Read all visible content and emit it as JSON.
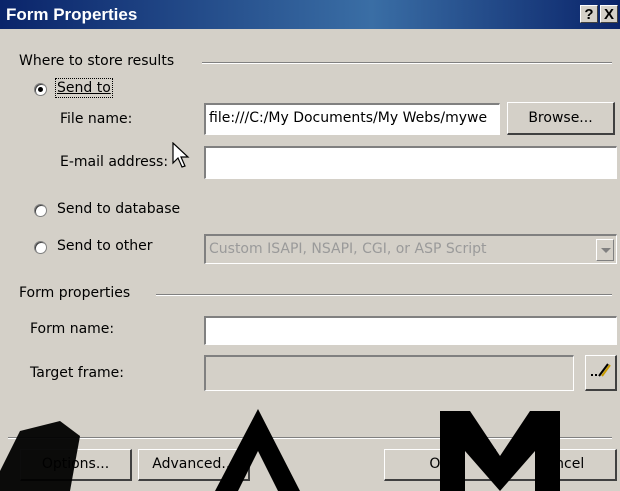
{
  "window": {
    "title": "Form Properties",
    "help_button": "?",
    "close_button": "X"
  },
  "store_group": {
    "label": "Where to store results",
    "send_to": {
      "label": "Send to",
      "selected": true
    },
    "file_name": {
      "label": "File name:",
      "value": "file:///C:/My Documents/My Webs/mywe"
    },
    "browse_button": "Browse...",
    "email": {
      "label": "E-mail address:",
      "value": ""
    },
    "send_to_database": {
      "label": "Send to database",
      "selected": false
    },
    "send_to_other": {
      "label": "Send to other",
      "selected": false,
      "combo_value": "Custom ISAPI, NSAPI, CGI, or ASP Script"
    }
  },
  "form_group": {
    "label": "Form properties",
    "form_name": {
      "label": "Form name:",
      "value": ""
    },
    "target_frame": {
      "label": "Target frame:",
      "value": ""
    },
    "target_frame_button_icon": "pencil-icon"
  },
  "buttons": {
    "options": "Options...",
    "advanced": "Advanced...",
    "ok": "OK",
    "cancel": "Cancel"
  },
  "icons": {
    "cursor": "arrow-cursor-icon"
  }
}
